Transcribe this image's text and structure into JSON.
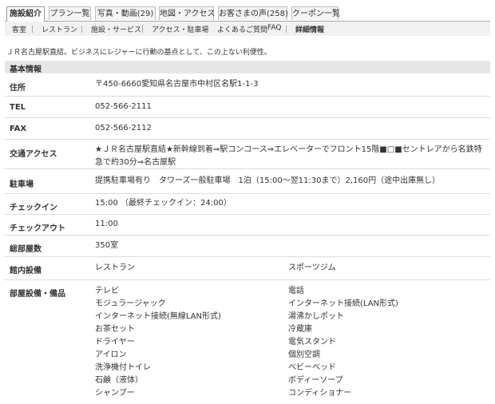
{
  "tabs": [
    "施設紹介",
    "プラン一覧",
    "写真・動画(29)",
    "地図・アクセス",
    "お客さまの声(258)",
    "クーポン一覧"
  ],
  "subnav": [
    "客室",
    "レストラン",
    "施設・サービス",
    "アクセス・駐車場",
    "よくあるご質問",
    "FAQ",
    "詳細情報"
  ],
  "intro": "ＪＲ名古屋駅直結。ビジネスにレジャーに行動の基点として、この上ない利便性。",
  "section_title": "基本情報",
  "info": {
    "address_label": "住所",
    "address": "〒450-6660愛知県名古屋市中村区名駅1-1-3",
    "tel_label": "TEL",
    "tel": "052-566-2111",
    "fax_label": "FAX",
    "fax": "052-566-2112",
    "access_label": "交通アクセス",
    "access": "★ＪＲ名古屋駅直結★新幹線到着⇒駅コンコース⇒エレベーターでフロント15階■□■セントレアから名鉄特急で約30分⇒名古屋駅",
    "parking_label": "駐車場",
    "parking": "提携駐車場有り　タワーズ一般駐車場　1泊（15:00～翌11:30まで）2,160円（途中出庫無し）",
    "checkin_label": "チェックイン",
    "checkin": "15:00 （最終チェックイン：24:00）",
    "checkout_label": "チェックアウト",
    "checkout": "11:00",
    "rooms_label": "総部屋数",
    "rooms": "350室",
    "facilities_label": "館内設備",
    "facilities": [
      "レストラン",
      "スポーツジム"
    ],
    "amenities_label": "部屋設備・備品",
    "amenities_left": [
      "テレビ",
      "モジュラージャック",
      "インターネット接続(無線LAN形式)",
      "お茶セット",
      "ドライヤー",
      "アイロン",
      "洗浄機付トイレ",
      "石鹸（液体）",
      "シャンプー"
    ],
    "amenities_right": [
      "電話",
      "インターネット接続(LAN形式)",
      "湯沸かしポット",
      "冷蔵庫",
      "電気スタンド",
      "個別空調",
      "ベビーベッド",
      "ボディーソープ",
      "コンディショナー"
    ]
  }
}
